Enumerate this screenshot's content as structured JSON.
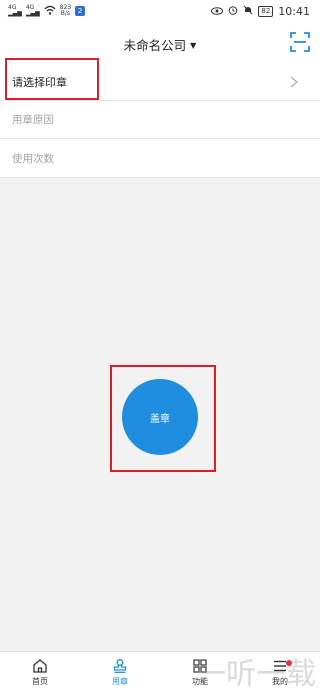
{
  "status_bar": {
    "sim1": "4G",
    "sim2": "4G",
    "net_speed_value": "823",
    "net_speed_unit": "B/s",
    "badge": "2",
    "battery": "82",
    "time": "10:41"
  },
  "header": {
    "company": "未命名公司"
  },
  "form": {
    "seal_select": "请选择印章",
    "reason_placeholder": "用章原因",
    "count_placeholder": "使用次数"
  },
  "stamp_button": {
    "label": "盖章",
    "color": "#1f8ee0"
  },
  "highlight_color": "#d6202b",
  "tabbar": {
    "tabs": [
      {
        "label": "首页",
        "icon": "home-icon"
      },
      {
        "label": "用章",
        "icon": "stamp-icon",
        "active": true
      },
      {
        "label": "功能",
        "icon": "grid-icon"
      },
      {
        "label": "我的",
        "icon": "menu-icon",
        "has_dot": true
      }
    ]
  },
  "watermark": {
    "text": "一听一载"
  }
}
